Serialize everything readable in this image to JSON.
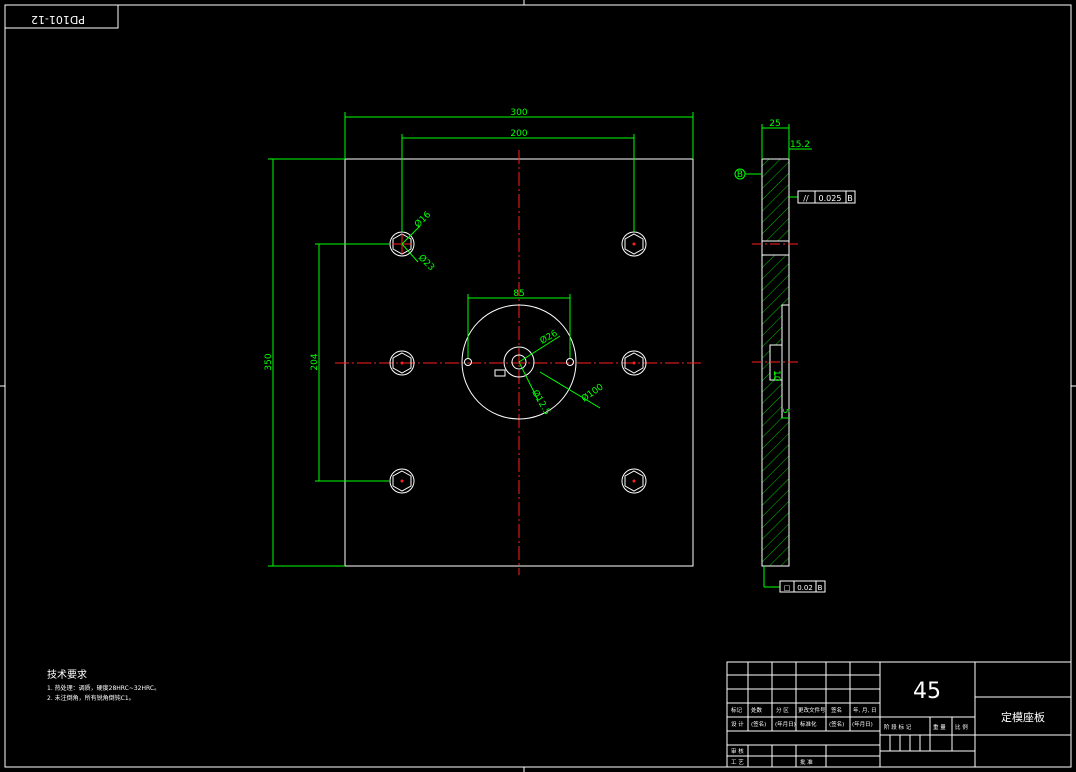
{
  "drawing_number": "PD101-12",
  "front_view": {
    "dims": {
      "width_total": "300",
      "width_holes": "200",
      "height_total": "350",
      "height_holes": "204",
      "hub_span": "85",
      "hole_d16": "Ø16",
      "hole_d23": "Ø23",
      "bore_d26": "Ø26",
      "bore_d12_5": "Ø12.5",
      "ring_d100": "Ø100"
    }
  },
  "side_view": {
    "dims": {
      "thickness": "25",
      "step": "15.2",
      "recess_depth": "10",
      "small": "5"
    },
    "datum_label": "B",
    "parallelism": {
      "symbol": "//",
      "tol": "0.025",
      "datum": "B"
    },
    "flatness": {
      "symbol": "□",
      "tol": "0.02",
      "datum": "B"
    }
  },
  "notes": {
    "title": "技术要求",
    "line1": "1. 热处理：调质，硬度28HRC~32HRC。",
    "line2": "2. 未注倒角，所有锐角倒钝C1。"
  },
  "title_block": {
    "material": "45",
    "part_name": "定模座板",
    "row_labels": {
      "revision": "标记",
      "count": "处数",
      "zone": "分 区",
      "doc_no": "更改文件号",
      "signature": "签名",
      "date": "年, 月, 日"
    },
    "design_row": {
      "designed": "设 计",
      "sig": "(签名)",
      "date": "(年月日)",
      "standardize": "标准化",
      "sig2": "(签名)",
      "date2": "(年月日)"
    },
    "stage_labels": [
      "阶 段 标 记",
      "重 量",
      "比 例"
    ],
    "review": "审 核",
    "process": "工 艺",
    "approve": "批 准"
  }
}
